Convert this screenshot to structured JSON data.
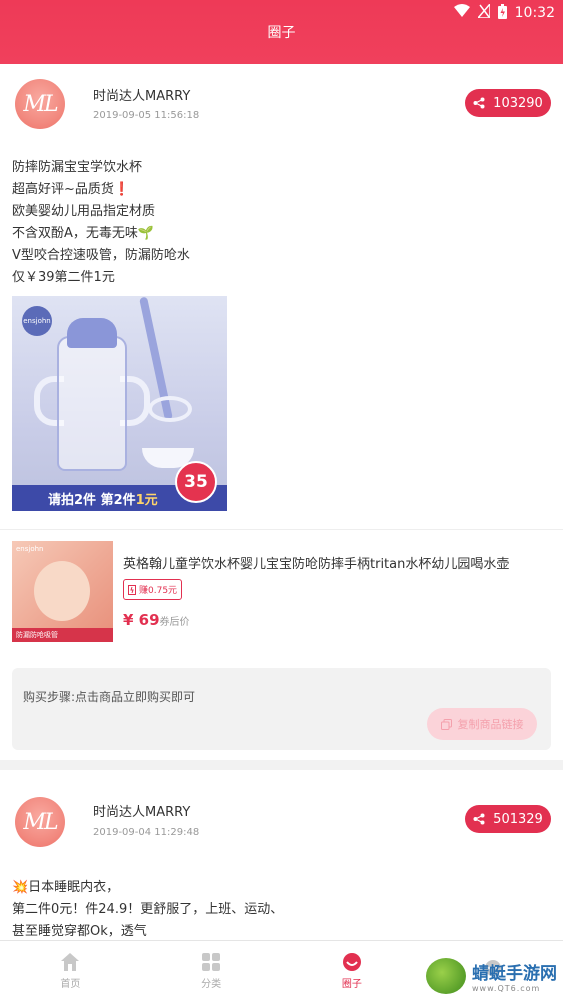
{
  "status": {
    "time": "10:32"
  },
  "header": {
    "title": "圈子"
  },
  "posts": [
    {
      "avatar_text": "ML",
      "username": "时尚达人MARRY",
      "time": "2019-09-05 11:56:18",
      "share_count": "103290",
      "description": "防摔防漏宝宝学饮水杯\n超高好评~品质货❗\n欧美婴幼儿用品指定材质\n不含双酚A，无毒无味🌱\nV型咬合控速吸管，防漏防呛水\n仅￥39第二件1元",
      "image": {
        "brand": "ensjohn",
        "banner_a": "请拍2件  第2件",
        "banner_b": "1元",
        "badge": "35"
      },
      "goods": {
        "thumb_brand": "ensjohn",
        "thumb_tag": "防漏防呛吸管",
        "title": "英格翰儿童学饮水杯婴儿宝宝防呛防摔手柄tritan水杯幼儿园喝水壶",
        "earn": "赚0.75元",
        "price": "¥ 69",
        "price_suffix": "券后价"
      },
      "steps": {
        "text": "购买步骤:点击商品立即购买即可",
        "copy_label": "复制商品链接"
      }
    },
    {
      "avatar_text": "ML",
      "username": "时尚达人MARRY",
      "time": "2019-09-04 11:29:48",
      "share_count": "501329",
      "description": "💥日本睡眠内衣，\n第二件0元！件24.9！更舒服了，上班、运动、\n甚至睡觉穿都Ok，透气"
    }
  ],
  "tabbar": [
    {
      "label": "首页",
      "icon": "home-icon",
      "active": false
    },
    {
      "label": "分类",
      "icon": "grid-icon",
      "active": false
    },
    {
      "label": "圈子",
      "icon": "circle-icon",
      "active": true
    },
    {
      "label": "",
      "icon": "message-icon",
      "active": false
    }
  ],
  "watermark": {
    "name": "蜻蜓手游网",
    "url": "www.QT6.com"
  },
  "colors": {
    "accent": "#e23050",
    "header": "#ee3a57"
  }
}
